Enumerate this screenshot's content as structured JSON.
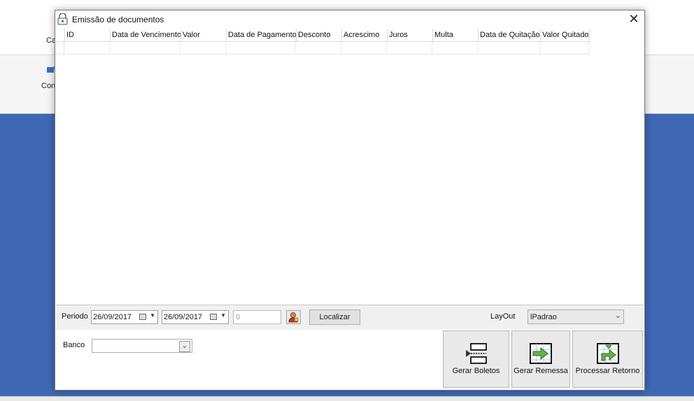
{
  "background": {
    "tab_label": "Ca",
    "ribbon_label": "Con"
  },
  "dialog": {
    "title": "Emissão de documentos",
    "close_glyph": "✕"
  },
  "grid": {
    "columns": [
      "ID",
      "Data de Vencimento",
      "Valor",
      "Data de Pagamento",
      "Desconto",
      "Acrescimo",
      "Juros",
      "Multa",
      "Data de Quitação",
      "Valor Quitado"
    ],
    "rows": []
  },
  "filters": {
    "periodo_label": "Periodo",
    "date_from": "26/09/2017",
    "date_to": "26/09/2017",
    "number_value": "0",
    "localizar_label": "Localizar",
    "layout_label": "LayOut",
    "layout_value": "lPadrao",
    "banco_label": "Banco",
    "banco_value": ""
  },
  "actions": {
    "gerar_boletos": "Gerar Boletos",
    "gerar_remessa": "Gerar Remessa",
    "processar_retorno": "Processar Retorno"
  },
  "icons": {
    "title": "lock-document-icon",
    "calendar": "calendar-icon",
    "search_person": "person-search-icon",
    "boletos": "boleto-icon",
    "remessa": "remessa-icon",
    "retorno": "retorno-icon"
  },
  "colors": {
    "app_blue": "#3f68b4",
    "button_face": "#e1e1e1"
  }
}
